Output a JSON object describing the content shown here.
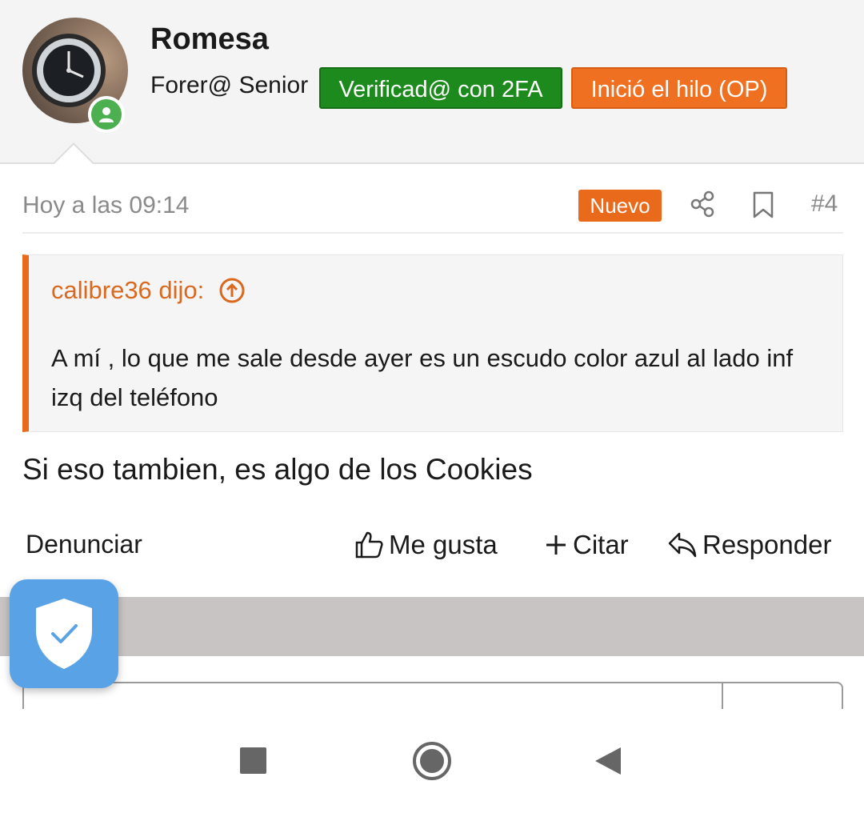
{
  "user": {
    "name": "Romesa",
    "title": "Forer@ Senior",
    "badges": [
      "Verificad@ con 2FA",
      "Inició el hilo (OP)"
    ],
    "online": true
  },
  "post": {
    "time": "Hoy a las 09:14",
    "new_label": "Nuevo",
    "number": "#4",
    "message": "Si eso tambien, es algo de los Cookies"
  },
  "quote": {
    "author_line": "calibre36 dijo:",
    "text": "A mí , lo que me sale desde ayer es un escudo color azul al lado inf izq del teléfono"
  },
  "actions": {
    "report": "Denunciar",
    "like": "Me gusta",
    "quote": "Citar",
    "reply": "Responder"
  },
  "colors": {
    "accent_orange": "#ea6a1c",
    "badge_green": "#1d8a1d",
    "shield_blue": "#5aa2e6"
  },
  "icons": [
    "share-icon",
    "bookmark-icon",
    "arrow-up-circle-icon",
    "thumbs-up-icon",
    "plus-icon",
    "reply-icon",
    "shield-check-icon",
    "stop-icon",
    "home-icon",
    "back-icon"
  ]
}
